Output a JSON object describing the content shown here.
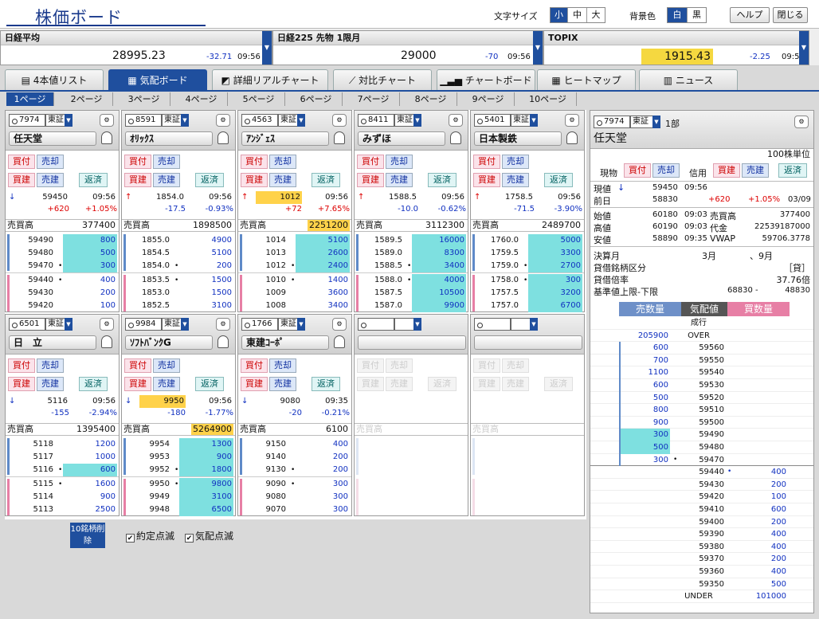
{
  "app": {
    "title": "株価ボード",
    "font_size_label": "文字サイズ",
    "font_sizes": [
      "小",
      "中",
      "大"
    ],
    "bg_label": "背景色",
    "bg_opts": [
      "白",
      "黒"
    ],
    "help": "ヘルプ",
    "close": "閉じる"
  },
  "indices": [
    {
      "name": "日経平均",
      "price": "28995.23",
      "change": "-32.71",
      "time": "09:56"
    },
    {
      "name": "日経225 先物 1限月",
      "price": "29000",
      "change": "-70",
      "time": "09:56"
    },
    {
      "name": "TOPIX",
      "price": "1915.43",
      "change": "-2.25",
      "time": "09:56"
    }
  ],
  "tabs": [
    "4本値リスト",
    "気配ボード",
    "詳細リアルチャート",
    "対比チャート",
    "チャートボード",
    "ヒートマップ",
    "ニュース"
  ],
  "pages": [
    "1ページ",
    "2ページ",
    "3ページ",
    "4ページ",
    "5ページ",
    "6ページ",
    "7ページ",
    "8ページ",
    "9ページ",
    "10ページ"
  ],
  "btn": {
    "buy": "買付",
    "sell": "売却",
    "long": "買建",
    "short": "売建",
    "repay": "返済"
  },
  "vol_label": "売買高",
  "panels": [
    {
      "code": "7974",
      "mkt": "東証",
      "name": "任天堂",
      "dir": "↓",
      "price": "59450",
      "time": "09:56",
      "chg": "+620",
      "pct": "+1.05%",
      "vol": "377400",
      "asks": [
        {
          "p": "59490",
          "q": "800"
        },
        {
          "p": "59480",
          "q": "500"
        },
        {
          "p": "59470",
          "q": "300"
        }
      ],
      "bids": [
        {
          "p": "59440",
          "q": "400"
        },
        {
          "p": "59430",
          "q": "200"
        },
        {
          "p": "59420",
          "q": "100"
        }
      ]
    },
    {
      "code": "8591",
      "mkt": "東証",
      "name": "ｵﾘｯｸｽ",
      "dir": "↑",
      "price": "1854.0",
      "time": "09:56",
      "chg": "-17.5",
      "pct": "-0.93%",
      "vol": "1898500",
      "asks": [
        {
          "p": "1855.0",
          "q": "4900"
        },
        {
          "p": "1854.5",
          "q": "5100"
        },
        {
          "p": "1854.0",
          "q": "200"
        }
      ],
      "bids": [
        {
          "p": "1853.5",
          "q": "1500"
        },
        {
          "p": "1853.0",
          "q": "1500"
        },
        {
          "p": "1852.5",
          "q": "3100"
        }
      ]
    },
    {
      "code": "4563",
      "mkt": "東証",
      "name": "ｱﾝｼﾞｪｽ",
      "dir": "↑",
      "price": "1012",
      "time": "09:56",
      "chg": "+72",
      "pct": "+7.65%",
      "vol": "2251200",
      "asks": [
        {
          "p": "1014",
          "q": "5100"
        },
        {
          "p": "1013",
          "q": "2600"
        },
        {
          "p": "1012",
          "q": "2400"
        }
      ],
      "bids": [
        {
          "p": "1010",
          "q": "1400"
        },
        {
          "p": "1009",
          "q": "3600"
        },
        {
          "p": "1008",
          "q": "3400"
        }
      ]
    },
    {
      "code": "8411",
      "mkt": "東証",
      "name": "みずほ",
      "dir": "↑",
      "price": "1588.5",
      "time": "09:56",
      "chg": "-10.0",
      "pct": "-0.62%",
      "vol": "3112300",
      "asks": [
        {
          "p": "1589.5",
          "q": "16000"
        },
        {
          "p": "1589.0",
          "q": "8300"
        },
        {
          "p": "1588.5",
          "q": "3400"
        }
      ],
      "bids": [
        {
          "p": "1588.0",
          "q": "4000"
        },
        {
          "p": "1587.5",
          "q": "10500"
        },
        {
          "p": "1587.0",
          "q": "9900"
        }
      ]
    },
    {
      "code": "5401",
      "mkt": "東証",
      "name": "日本製鉄",
      "dir": "↑",
      "price": "1758.5",
      "time": "09:56",
      "chg": "-71.5",
      "pct": "-3.90%",
      "vol": "2489700",
      "asks": [
        {
          "p": "1760.0",
          "q": "5000"
        },
        {
          "p": "1759.5",
          "q": "3300"
        },
        {
          "p": "1759.0",
          "q": "2700"
        }
      ],
      "bids": [
        {
          "p": "1758.0",
          "q": "300"
        },
        {
          "p": "1757.5",
          "q": "3200"
        },
        {
          "p": "1757.0",
          "q": "6700"
        }
      ]
    },
    {
      "code": "6501",
      "mkt": "東証",
      "name": "日　立",
      "dir": "↓",
      "price": "5116",
      "time": "09:56",
      "chg": "-155",
      "pct": "-2.94%",
      "vol": "1395400",
      "asks": [
        {
          "p": "5118",
          "q": "1200"
        },
        {
          "p": "5117",
          "q": "1000"
        },
        {
          "p": "5116",
          "q": "600"
        }
      ],
      "bids": [
        {
          "p": "5115",
          "q": "1600"
        },
        {
          "p": "5114",
          "q": "900"
        },
        {
          "p": "5113",
          "q": "2500"
        }
      ]
    },
    {
      "code": "9984",
      "mkt": "東証",
      "name": "ｿﾌﾄﾊﾞﾝｸG",
      "dir": "↓",
      "price": "9950",
      "time": "09:56",
      "chg": "-180",
      "pct": "-1.77%",
      "vol": "5264900",
      "asks": [
        {
          "p": "9954",
          "q": "1300"
        },
        {
          "p": "9953",
          "q": "900"
        },
        {
          "p": "9952",
          "q": "1800"
        }
      ],
      "bids": [
        {
          "p": "9950",
          "q": "9800"
        },
        {
          "p": "9949",
          "q": "3100"
        },
        {
          "p": "9948",
          "q": "6500"
        }
      ]
    },
    {
      "code": "1766",
      "mkt": "東証",
      "name": "東建ｺｰﾎﾟ",
      "dir": "↓",
      "price": "9080",
      "time": "09:35",
      "chg": "-20",
      "pct": "-0.21%",
      "vol": "6100",
      "asks": [
        {
          "p": "9150",
          "q": "400"
        },
        {
          "p": "9140",
          "q": "200"
        },
        {
          "p": "9130",
          "q": "200"
        }
      ],
      "bids": [
        {
          "p": "9090",
          "q": "300"
        },
        {
          "p": "9080",
          "q": "300"
        },
        {
          "p": "9070",
          "q": "300"
        }
      ]
    }
  ],
  "bottom": {
    "delete": "10銘柄削除",
    "chk1": "約定点滅",
    "chk2": "気配点滅"
  },
  "detail": {
    "code": "7974",
    "mkt": "東証",
    "section": "1部",
    "name": "任天堂",
    "unit": "100株単位",
    "genbutsu": "現物",
    "shinyo": "信用",
    "cur_label": "現値",
    "cur_dir": "↓",
    "cur": "59450",
    "cur_time": "09:56",
    "prev_label": "前日",
    "prev": "58830",
    "chg": "+620",
    "pct": "+1.05%",
    "prev_date": "03/09",
    "open_label": "始値",
    "open": "60180",
    "open_t": "09:03",
    "vol_label": "売買高",
    "vol": "377400",
    "high_label": "高値",
    "high": "60190",
    "high_t": "09:03",
    "amt_label": "代金",
    "amt": "22539187000",
    "low_label": "安値",
    "low": "58890",
    "low_t": "09:35",
    "vwap_label": "VWAP",
    "vwap": "59706.3778",
    "fy_label": "決算月",
    "fy1": "3月",
    "fy2": "、9月",
    "lend_label": "貸借銘柄区分",
    "lend": "［貸］",
    "ratio_label": "貸借倍率",
    "ratio": "37.76倍",
    "limit_label": "基準値上限-下限",
    "limit_hi": "68830 -",
    "limit_lo": "48830",
    "col_ask": "売数量",
    "col_price": "気配値",
    "col_bid": "買数量",
    "market_order": "成行",
    "over_label": "OVER",
    "over_qty": "205900",
    "under_label": "UNDER",
    "under_qty": "101000",
    "asks": [
      {
        "p": "59560",
        "q": "600"
      },
      {
        "p": "59550",
        "q": "700"
      },
      {
        "p": "59540",
        "q": "1100"
      },
      {
        "p": "59530",
        "q": "600"
      },
      {
        "p": "59520",
        "q": "500"
      },
      {
        "p": "59510",
        "q": "800"
      },
      {
        "p": "59500",
        "q": "900"
      },
      {
        "p": "59490",
        "q": "300"
      },
      {
        "p": "59480",
        "q": "500"
      },
      {
        "p": "59470",
        "q": "300"
      }
    ],
    "bids": [
      {
        "p": "59440",
        "q": "400"
      },
      {
        "p": "59430",
        "q": "200"
      },
      {
        "p": "59420",
        "q": "100"
      },
      {
        "p": "59410",
        "q": "600"
      },
      {
        "p": "59400",
        "q": "200"
      },
      {
        "p": "59390",
        "q": "400"
      },
      {
        "p": "59380",
        "q": "400"
      },
      {
        "p": "59370",
        "q": "200"
      },
      {
        "p": "59360",
        "q": "400"
      },
      {
        "p": "59350",
        "q": "500"
      }
    ]
  },
  "colors": {
    "accent": "#1f4f9e",
    "up": "#dd0000",
    "down": "#1030c0",
    "highlight": "#ffd24a",
    "quote_fill": "#7ee0e0"
  }
}
